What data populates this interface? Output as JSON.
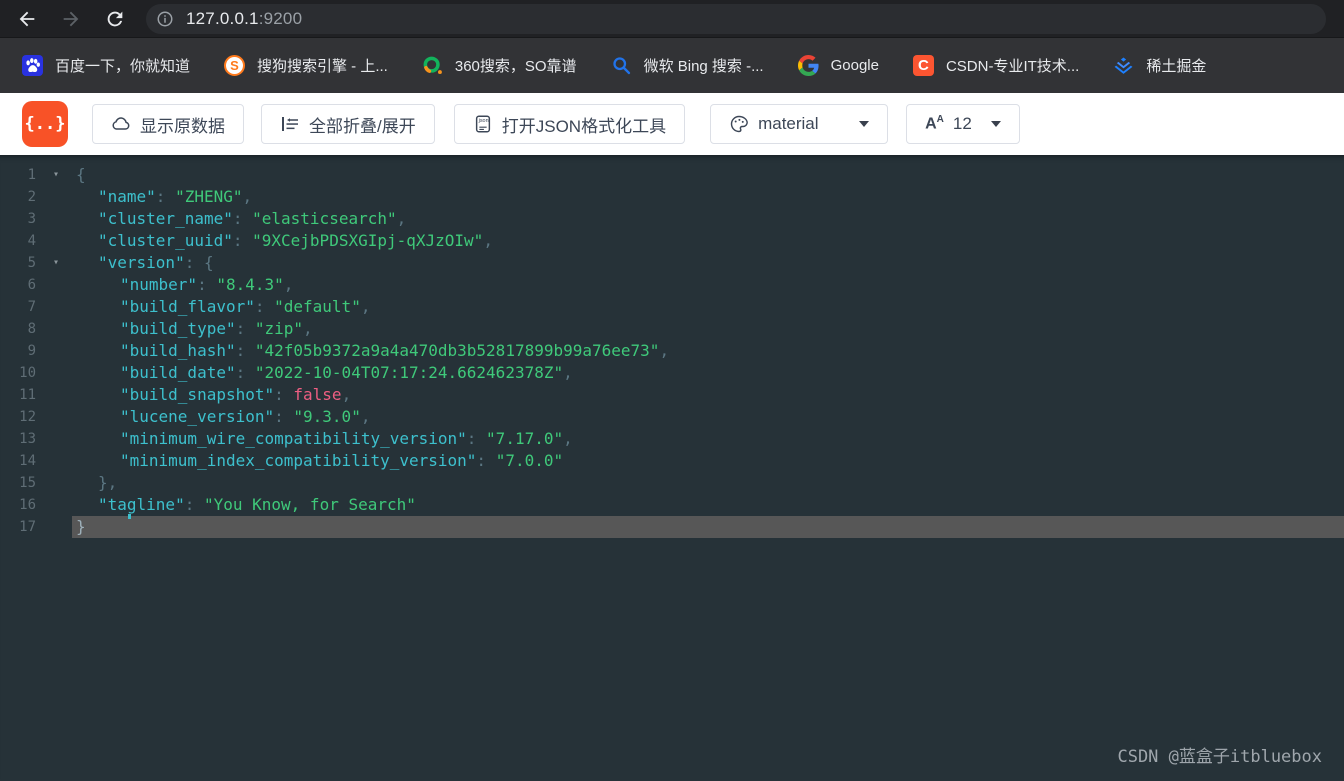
{
  "browser": {
    "url": {
      "host": "127.0.0.1",
      "port": ":9200"
    }
  },
  "bookmarks": [
    {
      "label": "百度一下，你就知道",
      "icon": "baidu-icon"
    },
    {
      "label": "搜狗搜索引擎 - 上...",
      "icon": "sogou-icon",
      "glyph": "S"
    },
    {
      "label": "360搜索，SO靠谱",
      "icon": "360-icon"
    },
    {
      "label": "微软 Bing 搜索 -...",
      "icon": "bing-icon"
    },
    {
      "label": "Google",
      "icon": "google-icon"
    },
    {
      "label": "CSDN-专业IT技术...",
      "icon": "csdn-icon",
      "glyph": "C"
    },
    {
      "label": "稀土掘金",
      "icon": "juejin-icon"
    }
  ],
  "formatter_toolbar": {
    "logo_text": "{..}",
    "show_raw_button": "显示原数据",
    "collapse_expand_button": "全部折叠/展开",
    "open_json_tool_button": "打开JSON格式化工具",
    "theme_dropdown_value": "material",
    "font_size_dropdown_value": "12"
  },
  "code": {
    "colors": {
      "background": "#263238",
      "key": "#3dc0cd",
      "string": "#3fc97a",
      "boolean": "#ef5e82",
      "punctuation": "#5b7682",
      "line_number": "#5f6d75",
      "highlight_row": "#575757"
    },
    "lines": [
      {
        "n": 1,
        "indent": 0,
        "fold": true,
        "segs": [
          [
            "punc",
            "{"
          ]
        ]
      },
      {
        "n": 2,
        "indent": 1,
        "segs": [
          [
            "key",
            "\"name\""
          ],
          [
            "punc",
            ": "
          ],
          [
            "str",
            "\"ZHENG\""
          ],
          [
            "punc",
            ","
          ]
        ]
      },
      {
        "n": 3,
        "indent": 1,
        "segs": [
          [
            "key",
            "\"cluster_name\""
          ],
          [
            "punc",
            ": "
          ],
          [
            "str",
            "\"elasticsearch\""
          ],
          [
            "punc",
            ","
          ]
        ]
      },
      {
        "n": 4,
        "indent": 1,
        "segs": [
          [
            "key",
            "\"cluster_uuid\""
          ],
          [
            "punc",
            ": "
          ],
          [
            "str",
            "\"9XCejbPDSXGIpj-qXJzOIw\""
          ],
          [
            "punc",
            ","
          ]
        ]
      },
      {
        "n": 5,
        "indent": 1,
        "fold": true,
        "segs": [
          [
            "key",
            "\"version\""
          ],
          [
            "punc",
            ": {"
          ]
        ]
      },
      {
        "n": 6,
        "indent": 2,
        "segs": [
          [
            "key",
            "\"number\""
          ],
          [
            "punc",
            ": "
          ],
          [
            "str",
            "\"8.4.3\""
          ],
          [
            "punc",
            ","
          ]
        ]
      },
      {
        "n": 7,
        "indent": 2,
        "segs": [
          [
            "key",
            "\"build_flavor\""
          ],
          [
            "punc",
            ": "
          ],
          [
            "str",
            "\"default\""
          ],
          [
            "punc",
            ","
          ]
        ]
      },
      {
        "n": 8,
        "indent": 2,
        "segs": [
          [
            "key",
            "\"build_type\""
          ],
          [
            "punc",
            ": "
          ],
          [
            "str",
            "\"zip\""
          ],
          [
            "punc",
            ","
          ]
        ]
      },
      {
        "n": 9,
        "indent": 2,
        "segs": [
          [
            "key",
            "\"build_hash\""
          ],
          [
            "punc",
            ": "
          ],
          [
            "str",
            "\"42f05b9372a9a4a470db3b52817899b99a76ee73\""
          ],
          [
            "punc",
            ","
          ]
        ]
      },
      {
        "n": 10,
        "indent": 2,
        "segs": [
          [
            "key",
            "\"build_date\""
          ],
          [
            "punc",
            ": "
          ],
          [
            "str",
            "\"2022-10-04T07:17:24.662462378Z\""
          ],
          [
            "punc",
            ","
          ]
        ]
      },
      {
        "n": 11,
        "indent": 2,
        "segs": [
          [
            "key",
            "\"build_snapshot\""
          ],
          [
            "punc",
            ": "
          ],
          [
            "bool",
            "false"
          ],
          [
            "punc",
            ","
          ]
        ]
      },
      {
        "n": 12,
        "indent": 2,
        "segs": [
          [
            "key",
            "\"lucene_version\""
          ],
          [
            "punc",
            ": "
          ],
          [
            "str",
            "\"9.3.0\""
          ],
          [
            "punc",
            ","
          ]
        ]
      },
      {
        "n": 13,
        "indent": 2,
        "segs": [
          [
            "key",
            "\"minimum_wire_compatibility_version\""
          ],
          [
            "punc",
            ": "
          ],
          [
            "str",
            "\"7.17.0\""
          ],
          [
            "punc",
            ","
          ]
        ]
      },
      {
        "n": 14,
        "indent": 2,
        "segs": [
          [
            "key",
            "\"minimum_index_compatibility_version\""
          ],
          [
            "punc",
            ": "
          ],
          [
            "str",
            "\"7.0.0\""
          ]
        ]
      },
      {
        "n": 15,
        "indent": 1,
        "segs": [
          [
            "punc",
            "},"
          ]
        ]
      },
      {
        "n": 16,
        "indent": 1,
        "segs": [
          [
            "key",
            "\"tagline\""
          ],
          [
            "punc",
            ": "
          ],
          [
            "str",
            "\"You Know, for Search\""
          ]
        ]
      },
      {
        "n": 17,
        "indent": 0,
        "highlight": true,
        "segs": [
          [
            "punc",
            "}"
          ]
        ]
      }
    ]
  },
  "watermark": "CSDN @蓝盒子itbluebox"
}
